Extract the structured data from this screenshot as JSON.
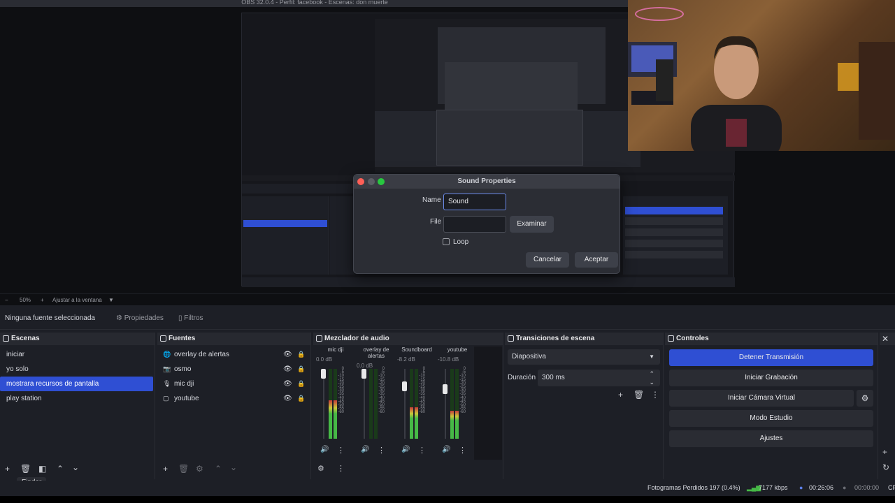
{
  "window_title": "OBS 32.0.4 - Perfil: facebook - Escenas: don muerte",
  "dialog": {
    "title": "Sound Properties",
    "name_label": "Name",
    "name_value": "Sound",
    "file_label": "File",
    "file_value": "",
    "browse_label": "Examinar",
    "loop_label": "Loop",
    "loop_checked": false,
    "cancel_label": "Cancelar",
    "accept_label": "Aceptar"
  },
  "zoom": {
    "minus": "−",
    "level": "50%",
    "plus": "+",
    "fit_label": "Ajustar a la ventana"
  },
  "source_bar": {
    "status": "Ninguna fuente seleccionada",
    "properties_label": "Propiedades",
    "filters_label": "Filtros"
  },
  "scenes": {
    "title": "Escenas",
    "items": [
      "iniciar",
      "yo solo",
      "mostrara recursos de pantalla",
      "play station"
    ],
    "selected_index": 2
  },
  "sources": {
    "title": "Fuentes",
    "items": [
      {
        "label": "overlay de alertas",
        "icon": "globe-icon",
        "locked": false
      },
      {
        "label": "osmo",
        "icon": "camera-icon",
        "locked": false
      },
      {
        "label": "mic dji",
        "icon": "microphone-icon",
        "locked": true
      },
      {
        "label": "youtube",
        "icon": "window-icon",
        "locked": false
      }
    ]
  },
  "mixer": {
    "title": "Mezclador de audio",
    "scale": [
      "0",
      "-5",
      "-10",
      "-15",
      "-20",
      "-25",
      "-30",
      "-35",
      "-40",
      "-45",
      "-50",
      "-55",
      "-60"
    ],
    "channels": [
      {
        "name": "mic dji",
        "db": "0.0 dB",
        "level": 0.55
      },
      {
        "name": "overlay de alertas",
        "db": "0.0 dB",
        "level": 0.0
      },
      {
        "name": "Soundboard",
        "db": "-8.2 dB",
        "level": 0.45
      },
      {
        "name": "youtube",
        "db": "-10.8 dB",
        "level": 0.4
      }
    ]
  },
  "transitions": {
    "title": "Transiciones de escena",
    "selected": "Diapositiva",
    "duration_label": "Duración",
    "duration_value": "300 ms"
  },
  "controls": {
    "title": "Controles",
    "buttons": [
      "Detener Transmisión",
      "Iniciar Grabación",
      "Iniciar Cámara Virtual",
      "Modo Estudio",
      "Ajustes"
    ]
  },
  "finder_label": "Finder",
  "status": {
    "dropped_frames": "Fotogramas Perdidos 197 (0.4%)",
    "bitrate": "7177 kbps",
    "stream_time": "00:26:06",
    "rec_time": "00:00:00",
    "cpu": "CF"
  },
  "colors": {
    "accent": "#2f4fd3",
    "background": "#1d1f26",
    "panel": "#272930"
  }
}
